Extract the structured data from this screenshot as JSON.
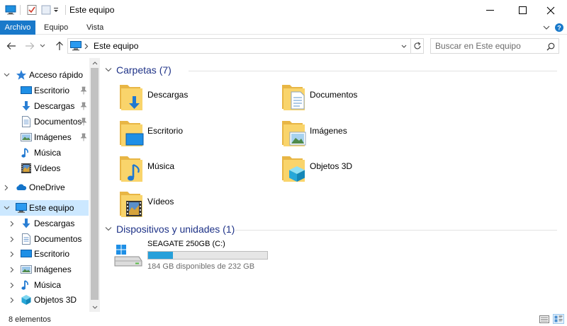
{
  "window": {
    "title": "Este equipo",
    "minimize": "minimize-icon",
    "maximize": "maximize-icon",
    "close": "close-icon"
  },
  "ribbon": {
    "tabs": [
      "Archivo",
      "Equipo",
      "Vista"
    ],
    "accent": "#1979ca"
  },
  "address": {
    "path": "Este equipo",
    "search_placeholder": "Buscar en Este equipo"
  },
  "nav": {
    "quick_access": "Acceso rápido",
    "quick_items": [
      "Escritorio",
      "Descargas",
      "Documentos",
      "Imágenes",
      "Música",
      "Vídeos"
    ],
    "onedrive": "OneDrive",
    "this_pc": "Este equipo",
    "pc_items": [
      "Descargas",
      "Documentos",
      "Escritorio",
      "Imágenes",
      "Música",
      "Objetos 3D"
    ],
    "selected_color": "#cce8ff"
  },
  "content": {
    "folders_header": "Carpetas (7)",
    "folders": [
      "Descargas",
      "Documentos",
      "Escritorio",
      "Imágenes",
      "Música",
      "Objetos 3D",
      "Vídeos"
    ],
    "devices_header": "Dispositivos y unidades (1)",
    "drive": {
      "name": "SEAGATE 250GB (C:)",
      "free_text": "184 GB disponibles de 232 GB",
      "used_fraction": 0.207
    }
  },
  "status": {
    "count": "8 elementos"
  }
}
